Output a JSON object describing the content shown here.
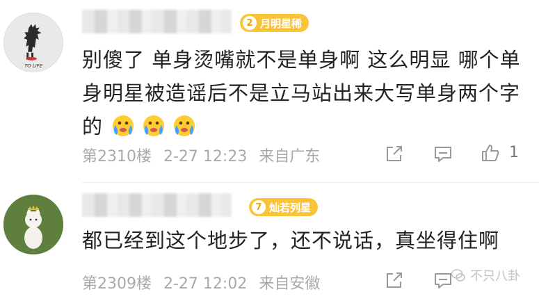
{
  "comments": [
    {
      "badge": {
        "level": "2",
        "label": "月明星稀"
      },
      "avatar_text": "TO LIFE",
      "text": "别傻了 单身烫嘴就不是单身啊 这么明显 哪个单身明星被造谣后不是立马站出来大写单身两个字的",
      "emoji": [
        "crying-face-emoji",
        "crying-face-emoji",
        "crying-face-emoji"
      ],
      "floor": "第2310楼",
      "time": "2-27 12:23",
      "source": "来自广东",
      "likes": "1"
    },
    {
      "badge": {
        "level": "7",
        "label": "灿若列星"
      },
      "text": "都已经到这个地步了，还不说话，真坐得住啊",
      "floor": "第2309楼",
      "time": "2-27 12:02",
      "source": "来自安徽"
    }
  ],
  "watermark": "不只八卦",
  "colors": {
    "badge": "#f9c33a",
    "meta": "#a9a9a9",
    "text": "#222222"
  }
}
